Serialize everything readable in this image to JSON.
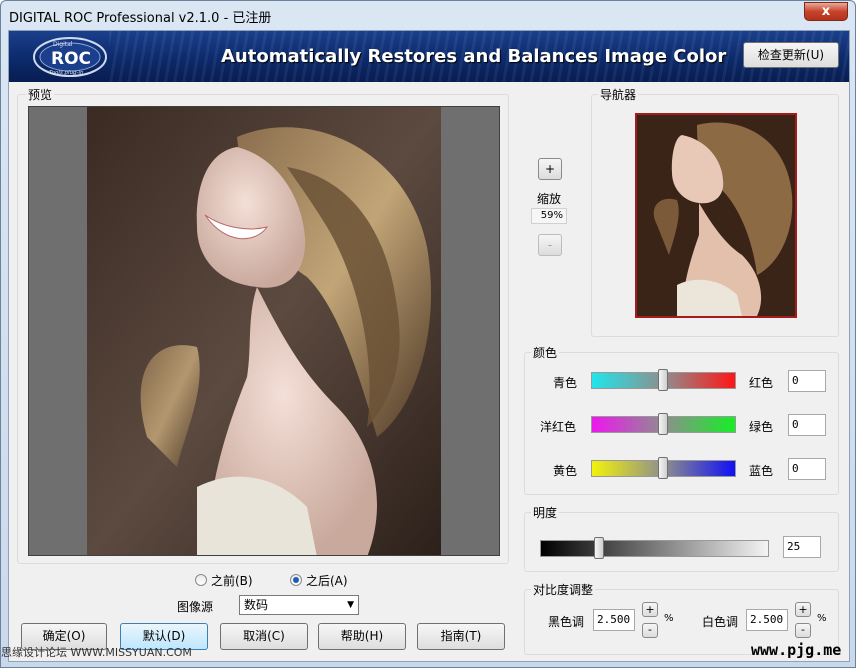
{
  "window": {
    "title": "DIGITAL ROC Professional v2.1.0 - 已注册",
    "close_glyph": "x"
  },
  "banner": {
    "logo_text": "ROC",
    "logo_small_top": "Digital",
    "logo_small_bottom": "Tools plug-in",
    "tagline": "Automatically Restores and Balances Image Color",
    "check_update_label": "检查更新(U)"
  },
  "preview": {
    "label": "预览",
    "radio_before_label": "之前(B)",
    "radio_after_label": "之后(A)",
    "selected": "after",
    "image_source_label": "图像源",
    "image_source_value": "数码"
  },
  "zoom": {
    "label": "缩放",
    "plus": "+",
    "minus": "-",
    "value": "59%"
  },
  "navigator": {
    "label": "导航器"
  },
  "color": {
    "label": "颜色",
    "rows": [
      {
        "left": "青色",
        "right": "红色",
        "value": "0",
        "position": 0.5,
        "from": "#1fe6ea",
        "to": "#ff1515"
      },
      {
        "left": "洋红色",
        "right": "绿色",
        "value": "0",
        "position": 0.5,
        "from": "#ee16ee",
        "to": "#16ee26"
      },
      {
        "left": "黄色",
        "right": "蓝色",
        "value": "0",
        "position": 0.5,
        "from": "#f2f20c",
        "to": "#1010f4"
      }
    ]
  },
  "brightness": {
    "label": "明度",
    "value": "25",
    "position": 0.25
  },
  "contrast": {
    "label": "对比度调整",
    "black_label": "黑色调",
    "black_value": "2.500",
    "white_label": "白色调",
    "white_value": "2.500",
    "unit": "%",
    "plus": "+",
    "minus": "-"
  },
  "buttons": {
    "ok": "确定(O)",
    "default": "默认(D)",
    "cancel": "取消(C)",
    "help": "帮助(H)",
    "guide": "指南(T)"
  },
  "watermarks": {
    "left": "思缘设计论坛 WWW.MISSYUAN.COM",
    "right": "www.pjg.me"
  },
  "colors": {
    "banner": "#0c2a6b",
    "focus": "#3c7fb1",
    "nav_border": "#a51b1b"
  }
}
